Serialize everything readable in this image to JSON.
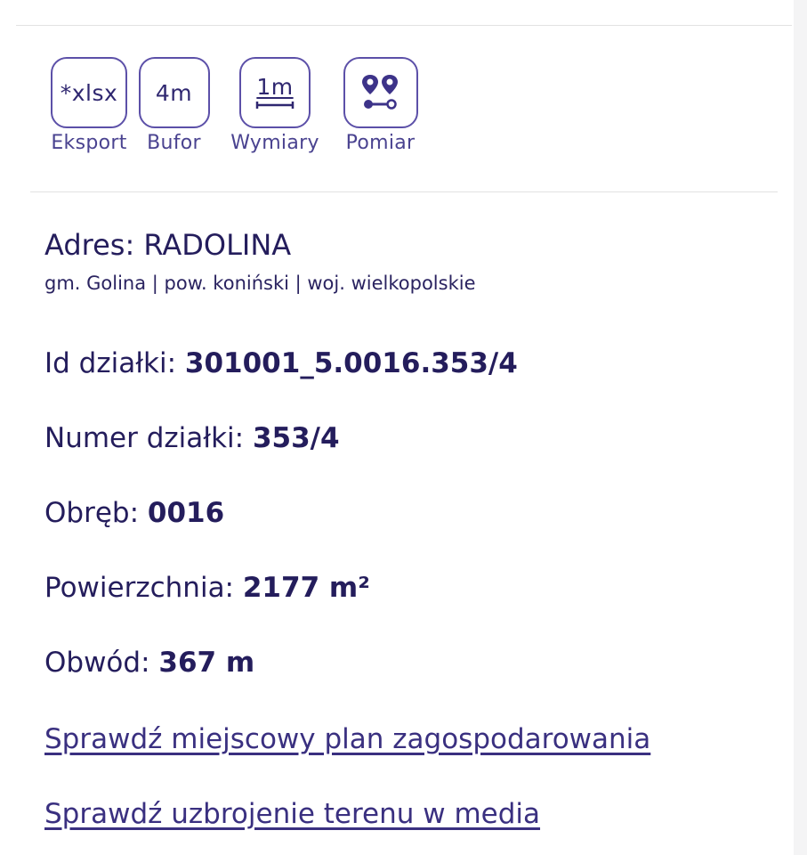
{
  "tools": [
    {
      "icon_text": "*xlsx",
      "label": "Eksport"
    },
    {
      "icon_text": "4m",
      "label": "Bufor"
    },
    {
      "icon_text": "1m",
      "label": "Wymiary"
    },
    {
      "icon_text": "",
      "label": "Pomiar"
    }
  ],
  "address": {
    "title": "Adres: RADOLINA",
    "subtitle": "gm. Golina | pow. koniński | woj. wielkopolskie"
  },
  "parcel": {
    "id": {
      "label": "Id działki: ",
      "value": "301001_5.0016.353/4"
    },
    "number": {
      "label": "Numer działki: ",
      "value": "353/4"
    },
    "precinct": {
      "label": "Obręb: ",
      "value": "0016"
    },
    "area": {
      "label": "Powierzchnia: ",
      "value": "2177 m²"
    },
    "perimeter": {
      "label": "Obwód: ",
      "value": "367 m"
    }
  },
  "links": {
    "plan": "Sprawdź miejscowy plan zagospodarowania",
    "media": "Sprawdź uzbrojenie terenu w media"
  },
  "icons": {
    "pomiar": "route-pins-icon",
    "wymiary": "ruler-icon"
  },
  "colors": {
    "accent": "#5c50a8",
    "text": "#241d5c"
  }
}
